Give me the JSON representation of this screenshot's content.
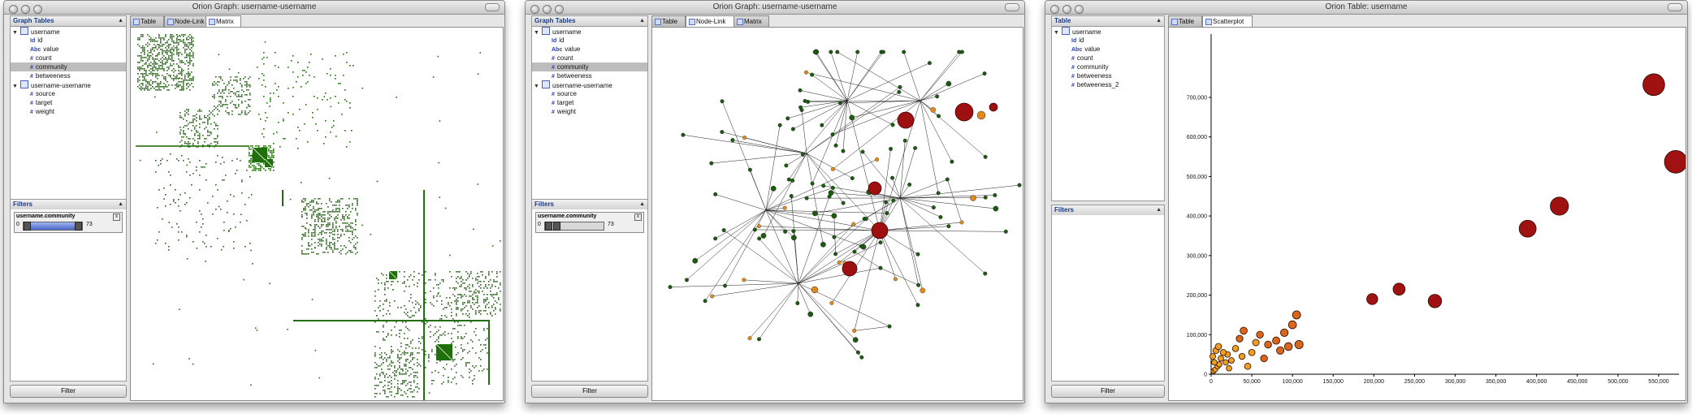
{
  "window1": {
    "title": "Orion Graph: username-username",
    "sidebar_title": "Graph Tables",
    "tree": [
      {
        "label": "username",
        "level": 0,
        "type": "table",
        "expanded": true
      },
      {
        "label": "id",
        "level": 1,
        "type": "key"
      },
      {
        "label": "value",
        "level": 1,
        "type": "text"
      },
      {
        "label": "count",
        "level": 1,
        "type": "numeric"
      },
      {
        "label": "community",
        "level": 1,
        "type": "numeric",
        "selected": true
      },
      {
        "label": "betweeness",
        "level": 1,
        "type": "numeric"
      },
      {
        "label": "username-username",
        "level": 0,
        "type": "table",
        "expanded": true
      },
      {
        "label": "source",
        "level": 1,
        "type": "numeric"
      },
      {
        "label": "target",
        "level": 1,
        "type": "numeric"
      },
      {
        "label": "weight",
        "level": 1,
        "type": "numeric"
      }
    ],
    "filters_title": "Filters",
    "filter_name": "username.community",
    "filter_min": "0",
    "filter_max": "73",
    "filter_button": "Filter",
    "tabs": [
      "Table",
      "Node-Link",
      "Matrix"
    ],
    "active_tab": "Matrix",
    "view": "matrix",
    "matrix_color": "#1f6f0a"
  },
  "window2": {
    "title": "Orion Graph: username-username",
    "sidebar_title": "Graph Tables",
    "tree": [
      {
        "label": "username",
        "level": 0,
        "type": "table",
        "expanded": true
      },
      {
        "label": "id",
        "level": 1,
        "type": "key"
      },
      {
        "label": "value",
        "level": 1,
        "type": "text"
      },
      {
        "label": "count",
        "level": 1,
        "type": "numeric"
      },
      {
        "label": "community",
        "level": 1,
        "type": "numeric",
        "selected": true
      },
      {
        "label": "betweeness",
        "level": 1,
        "type": "numeric"
      },
      {
        "label": "username-username",
        "level": 0,
        "type": "table",
        "expanded": true
      },
      {
        "label": "source",
        "level": 1,
        "type": "numeric"
      },
      {
        "label": "target",
        "level": 1,
        "type": "numeric"
      },
      {
        "label": "weight",
        "level": 1,
        "type": "numeric"
      }
    ],
    "filters_title": "Filters",
    "filter_name": "username.community",
    "filter_min": "0",
    "filter_max": "73",
    "filter_button": "Filter",
    "tabs": [
      "Table",
      "Node-Link",
      "Matrix"
    ],
    "active_tab": "Node-Link",
    "view": "node-link",
    "node_colors": {
      "small": "#1e5a12",
      "mid": "#e08a1e",
      "large": "#9e1010"
    }
  },
  "window3": {
    "title": "Orion Table: username",
    "sidebar_title": "Table",
    "tree": [
      {
        "label": "username",
        "level": 0,
        "type": "table",
        "expanded": true
      },
      {
        "label": "id",
        "level": 1,
        "type": "key"
      },
      {
        "label": "value",
        "level": 1,
        "type": "text"
      },
      {
        "label": "count",
        "level": 1,
        "type": "numeric"
      },
      {
        "label": "community",
        "level": 1,
        "type": "numeric"
      },
      {
        "label": "betweeness",
        "level": 1,
        "type": "numeric"
      },
      {
        "label": "betweeness_2",
        "level": 1,
        "type": "numeric"
      }
    ],
    "filters_title": "Filters",
    "filter_button": "Filter",
    "tabs": [
      "Table",
      "Scatterplot"
    ],
    "active_tab": "Scatterplot",
    "view": "scatterplot"
  },
  "icons": {
    "numeric": "#",
    "text": "Abc",
    "key": "Id",
    "table": "table-icon"
  },
  "chart_data": {
    "type": "scatter",
    "title": "",
    "xlabel": "",
    "ylabel": "",
    "xlim": [
      0,
      575000
    ],
    "ylim": [
      0,
      860000
    ],
    "x_ticks": [
      "0",
      "50,000",
      "100,000",
      "150,000",
      "200,000",
      "250,000",
      "300,000",
      "350,000",
      "400,000",
      "450,000",
      "500,000",
      "550,000"
    ],
    "y_ticks": [
      "0",
      "100,000",
      "200,000",
      "300,000",
      "400,000",
      "500,000",
      "600,000",
      "700,000"
    ],
    "x_tick_values": [
      0,
      50000,
      100000,
      150000,
      200000,
      250000,
      300000,
      350000,
      400000,
      450000,
      500000,
      550000
    ],
    "y_tick_values": [
      0,
      100000,
      200000,
      300000,
      400000,
      500000,
      600000,
      700000
    ],
    "grid": false,
    "points": [
      {
        "x": 3000,
        "y": 8000
      },
      {
        "x": 5000,
        "y": 12000
      },
      {
        "x": 8000,
        "y": 20000
      },
      {
        "x": 4000,
        "y": 30000
      },
      {
        "x": 10000,
        "y": 25000
      },
      {
        "x": 12000,
        "y": 40000
      },
      {
        "x": 15000,
        "y": 55000
      },
      {
        "x": 6000,
        "y": 60000
      },
      {
        "x": 9000,
        "y": 70000
      },
      {
        "x": 2000,
        "y": 45000
      },
      {
        "x": 18000,
        "y": 30000
      },
      {
        "x": 20000,
        "y": 50000
      },
      {
        "x": 22000,
        "y": 15000
      },
      {
        "x": 25000,
        "y": 35000
      },
      {
        "x": 30000,
        "y": 65000
      },
      {
        "x": 35000,
        "y": 90000
      },
      {
        "x": 38000,
        "y": 45000
      },
      {
        "x": 40000,
        "y": 110000
      },
      {
        "x": 45000,
        "y": 20000
      },
      {
        "x": 50000,
        "y": 55000
      },
      {
        "x": 55000,
        "y": 80000
      },
      {
        "x": 60000,
        "y": 100000
      },
      {
        "x": 65000,
        "y": 40000
      },
      {
        "x": 70000,
        "y": 75000
      },
      {
        "x": 80000,
        "y": 85000
      },
      {
        "x": 85000,
        "y": 60000
      },
      {
        "x": 90000,
        "y": 105000
      },
      {
        "x": 95000,
        "y": 70000
      },
      {
        "x": 100000,
        "y": 125000
      },
      {
        "x": 105000,
        "y": 150000
      },
      {
        "x": 108000,
        "y": 75000
      },
      {
        "x": 198000,
        "y": 190000
      },
      {
        "x": 231000,
        "y": 215000
      },
      {
        "x": 275000,
        "y": 185000
      },
      {
        "x": 389000,
        "y": 368000
      },
      {
        "x": 428000,
        "y": 425000
      },
      {
        "x": 544000,
        "y": 732000
      },
      {
        "x": 571000,
        "y": 537000
      }
    ]
  }
}
